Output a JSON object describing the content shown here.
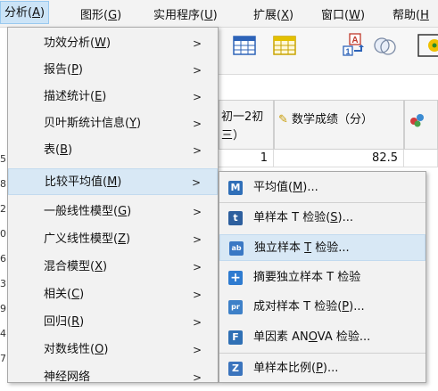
{
  "menubar": {
    "items": [
      {
        "label": "分析(",
        "key": "A",
        "tail": ")"
      },
      {
        "label": "图形(",
        "key": "G",
        "tail": ")"
      },
      {
        "label": "实用程序(",
        "key": "U",
        "tail": ")"
      },
      {
        "label": "扩展(",
        "key": "X",
        "tail": ")"
      },
      {
        "label": "窗口(",
        "key": "W",
        "tail": ")"
      },
      {
        "label": "帮助(",
        "key": "H",
        "tail": ""
      }
    ]
  },
  "analyze_menu": {
    "items": [
      {
        "label": "功效分析(",
        "key": "W",
        "tail": ")"
      },
      {
        "label": "报告(",
        "key": "P",
        "tail": ")"
      },
      {
        "label": "描述统计(",
        "key": "E",
        "tail": ")"
      },
      {
        "label": "贝叶斯统计信息(",
        "key": "Y",
        "tail": ")"
      },
      {
        "label": "表(",
        "key": "B",
        "tail": ")"
      },
      {
        "label": "比较平均值(",
        "key": "M",
        "tail": ")"
      },
      {
        "label": "一般线性模型(",
        "key": "G",
        "tail": ")"
      },
      {
        "label": "广义线性模型(",
        "key": "Z",
        "tail": ")"
      },
      {
        "label": "混合模型(",
        "key": "X",
        "tail": ")"
      },
      {
        "label": "相关(",
        "key": "C",
        "tail": ")"
      },
      {
        "label": "回归(",
        "key": "R",
        "tail": ")"
      },
      {
        "label": "对数线性(",
        "key": "O",
        "tail": ")"
      },
      {
        "label": "神经网络",
        "key": "",
        "tail": ""
      }
    ],
    "arrow": ">"
  },
  "compare_means_menu": {
    "items": [
      {
        "label": "平均值(",
        "key": "M",
        "tail": ")...",
        "icon": "M",
        "color": "#2f6fb8"
      },
      {
        "label": "单样本 T 检验(",
        "key": "S",
        "tail": ")...",
        "icon": "t",
        "color": "#2d5f9e"
      },
      {
        "label": "独立样本 ",
        "key": "T",
        "tail": " 检验...",
        "icon": "ab",
        "color": "#3a78c4"
      },
      {
        "label": "摘要独立样本 T 检验",
        "key": "",
        "tail": "",
        "icon": "+",
        "color": "#2e7bd0"
      },
      {
        "label": "成对样本 T 检验(",
        "key": "P",
        "tail": ")...",
        "icon": "pr",
        "color": "#3d80c8"
      },
      {
        "label": "单因素 AN",
        "key": "O",
        "tail": "VA 检验...",
        "icon": "F",
        "color": "#2f70b5"
      },
      {
        "label": "单样本比例(",
        "key": "P",
        "tail": ")...",
        "icon": "Z",
        "color": "#3b74bd"
      }
    ]
  },
  "editor": {
    "col1_header": "初一2初\n三）",
    "col2_header": "数学成绩（分）",
    "row_value_col1": "1",
    "row_value_col2": "82.5",
    "row_numbers": [
      "5",
      "8",
      "2",
      "0",
      "6",
      "3",
      "9",
      "4",
      "7"
    ]
  },
  "colors": {
    "highlight": "#d8e8f5",
    "menubar_active": "#cce4f7"
  }
}
